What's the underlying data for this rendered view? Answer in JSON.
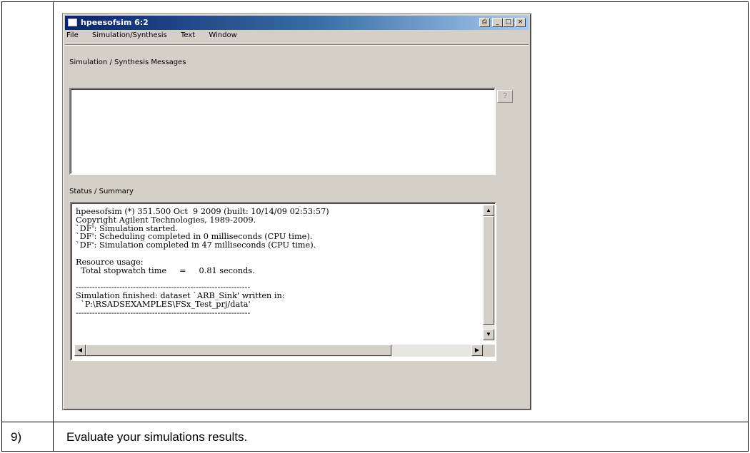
{
  "window": {
    "title": "hpeesofsim 6:2",
    "menu": [
      "File",
      "Simulation/Synthesis",
      "Text",
      "Window"
    ],
    "controls": {
      "print": "⎙",
      "minimize": "_",
      "maximize": "□",
      "close": "×"
    }
  },
  "messages_panel": {
    "label": "Simulation / Synthesis Messages",
    "help_button": "?"
  },
  "status_panel": {
    "label": "Status / Summary",
    "lines": [
      "hpeesofsim (*) 351.500 Oct  9 2009 (built: 10/14/09 02:53:57)",
      "Copyright Agilent Technologies, 1989-2009.",
      "`DF': Simulation started.",
      "`DF': Scheduling completed in 0 milliseconds (CPU time).",
      "`DF': Simulation completed in 47 milliseconds (CPU time).",
      "",
      "Resource usage:",
      "  Total stopwatch time     =     0.81 seconds.",
      "",
      "----------------------------------------------------------------",
      "Simulation finished: dataset `ARB_Sink' written in:",
      "  `P:\\RSADSEXAMPLES\\FSx_Test_prj/data'",
      "----------------------------------------------------------------"
    ]
  },
  "step": {
    "number": "9)",
    "text": "Evaluate your simulations results."
  }
}
